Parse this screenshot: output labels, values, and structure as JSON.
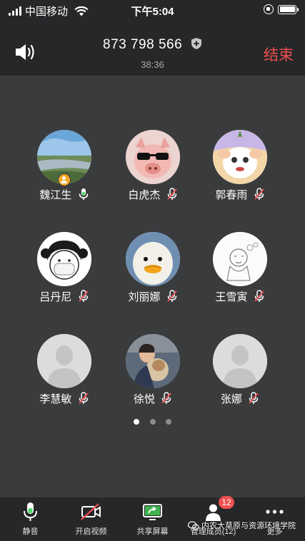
{
  "status_bar": {
    "carrier": "中国移动",
    "time": "下午5:04"
  },
  "header": {
    "meeting_id": "873 798 566",
    "duration": "38:36",
    "end_label": "结束"
  },
  "participants": [
    {
      "name": "魏江生",
      "mic": "on",
      "host": true,
      "avatar": "landscape"
    },
    {
      "name": "白虎杰",
      "mic": "muted",
      "host": false,
      "avatar": "pig"
    },
    {
      "name": "郭春雨",
      "mic": "muted",
      "host": false,
      "avatar": "goat-cartoon"
    },
    {
      "name": "吕丹尼",
      "mic": "muted",
      "host": false,
      "avatar": "girl-drawing"
    },
    {
      "name": "刘丽娜",
      "mic": "muted",
      "host": false,
      "avatar": "duck"
    },
    {
      "name": "王雪寅",
      "mic": "muted",
      "host": false,
      "avatar": "sketch"
    },
    {
      "name": "李慧敏",
      "mic": "muted",
      "host": false,
      "avatar": "default-person"
    },
    {
      "name": "徐悦",
      "mic": "muted",
      "host": false,
      "avatar": "photo-dog"
    },
    {
      "name": "张娜",
      "mic": "muted",
      "host": false,
      "avatar": "default-person"
    }
  ],
  "pager": {
    "pages": 3,
    "current": 1
  },
  "toolbar": {
    "items": [
      {
        "label": "静音",
        "icon": "microphone-icon"
      },
      {
        "label": "开启视频",
        "icon": "video-off-icon"
      },
      {
        "label": "共享屏幕",
        "icon": "share-screen-icon"
      },
      {
        "label": "管理成员(12)",
        "icon": "members-icon",
        "badge": "12"
      },
      {
        "label": "更多",
        "icon": "more-icon"
      }
    ]
  },
  "watermark": "内农大草原与资源环境学院",
  "colors": {
    "end_red": "#f0504f",
    "host_orange": "#f5a623",
    "mic_green": "#4cd964",
    "background": "#3a3b3d",
    "bar": "#262729"
  }
}
